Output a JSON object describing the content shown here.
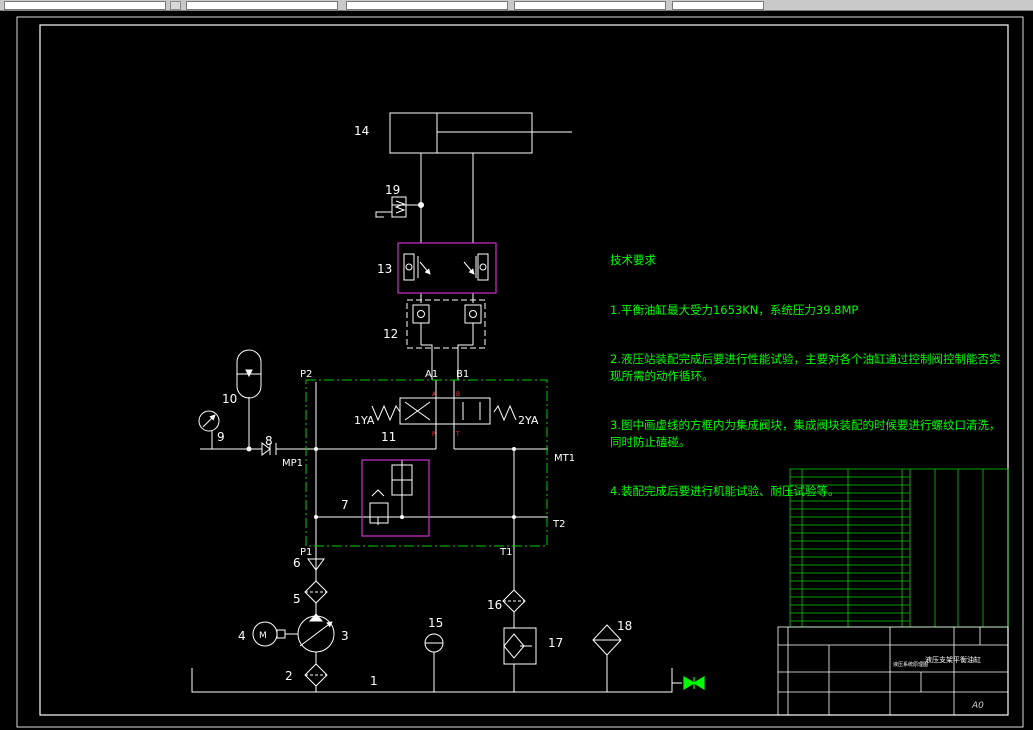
{
  "tech_requirements": {
    "heading": "技术要求",
    "lines": [
      "1.平衡油缸最大受力1653KN，系统压力39.8MP",
      "2.液压站装配完成后要进行性能试验，主要对各个油缸通过控制阀控制能否实现所需的动作循环。",
      "3.图中画虚线的方框内为集成阀块，集成阀块装配的时候要进行螺纹口清洗，同时防止磕碰。",
      "4.装配完成后要进行机能试验、耐压试验等。"
    ]
  },
  "callouts": {
    "c1": "1",
    "c2": "2",
    "c3": "3",
    "c4": "4",
    "c5": "5",
    "c6": "6",
    "c7": "7",
    "c8": "8",
    "c9": "9",
    "c10": "10",
    "c11": "11",
    "c12": "12",
    "c13": "13",
    "c14": "14",
    "c15": "15",
    "c16": "16",
    "c17": "17",
    "c18": "18",
    "c19": "19"
  },
  "ports": {
    "p1": "P1",
    "p2": "P2",
    "t1": "T1",
    "t2": "T2",
    "a1": "A1",
    "b1": "B1",
    "mp1": "MP1",
    "mt1": "MT1",
    "sol1": "1YA",
    "sol2": "2YA",
    "valve_p": "P",
    "valve_t": "T",
    "valve_a": "A",
    "valve_b": "B",
    "motor": "M"
  },
  "title_block": {
    "drawing_name": "液压支架平衡油缸",
    "sheet_size": "A0",
    "schematic_name": "液压系统原理图"
  },
  "colors": {
    "background": "#000000",
    "lines": "#ffffff",
    "text_notes": "#00ff00",
    "dashed_block": "#00cc00",
    "manifold": "#cc33cc",
    "port_marks": "#ff3333"
  }
}
